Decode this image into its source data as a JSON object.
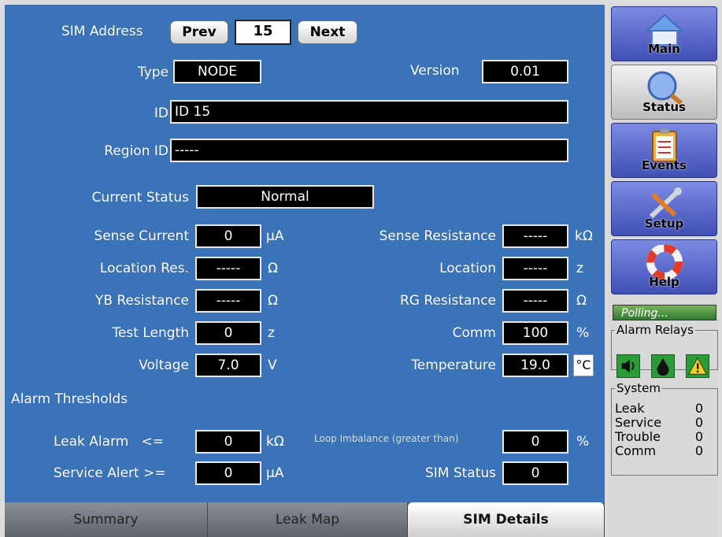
{
  "sim": {
    "address_label": "SIM Address",
    "prev_label": "Prev",
    "address_value": "15",
    "next_label": "Next"
  },
  "fields": {
    "type_label": "Type",
    "type_value": "NODE",
    "version_label": "Version",
    "version_value": "0.01",
    "id_label": "ID",
    "id_value": "ID 15",
    "region_label": "Region ID",
    "region_value": "-----",
    "current_status_label": "Current Status",
    "current_status_value": "Normal",
    "sense_current_label": "Sense Current",
    "sense_current_value": "0",
    "sense_current_unit": "μA",
    "sense_resistance_label": "Sense Resistance",
    "sense_resistance_value": "-----",
    "sense_resistance_unit": "kΩ",
    "location_res_label": "Location Res.",
    "location_res_value": "-----",
    "location_res_unit": "Ω",
    "location_label": "Location",
    "location_value": "-----",
    "location_unit": "z",
    "yb_resistance_label": "YB Resistance",
    "yb_resistance_value": "-----",
    "yb_resistance_unit": "Ω",
    "rg_resistance_label": "RG Resistance",
    "rg_resistance_value": "-----",
    "rg_resistance_unit": "Ω",
    "test_length_label": "Test Length",
    "test_length_value": "0",
    "test_length_unit": "z",
    "comm_label": "Comm",
    "comm_value": "100",
    "comm_unit": "%",
    "voltage_label": "Voltage",
    "voltage_value": "7.0",
    "voltage_unit": "V",
    "temperature_label": "Temperature",
    "temperature_value": "19.0",
    "temperature_unit": "°C",
    "alarm_thresholds_label": "Alarm Thresholds",
    "leak_alarm_label": "Leak Alarm   <=",
    "leak_alarm_value": "0",
    "leak_alarm_unit": "kΩ",
    "loop_imbalance_label": "Loop Imbalance (greater than)",
    "loop_imbalance_value": "0",
    "loop_imbalance_unit": "%",
    "service_alert_label": "Service Alert >=",
    "service_alert_value": "0",
    "service_alert_unit": "μA",
    "sim_status_label": "SIM Status",
    "sim_status_value": "0"
  },
  "tabs": [
    "Summary",
    "Leak Map",
    "SIM Details"
  ],
  "active_tab": "SIM Details",
  "nav": {
    "main": "Main",
    "status": "Status",
    "events": "Events",
    "setup": "Setup",
    "help": "Help",
    "selected": "Status",
    "icons": [
      "home-icon",
      "magnifier-icon",
      "clipboard-icon",
      "wrench-screwdriver-icon",
      "lifebuoy-icon"
    ]
  },
  "polling_text": "Polling...",
  "alarm_relays": {
    "title": "Alarm Relays",
    "icons": [
      "speaker-icon",
      "water-drop-icon",
      "warning-icon"
    ],
    "color": "#2a9b38"
  },
  "system": {
    "title": "System",
    "rows": [
      {
        "label": "Leak",
        "value": "0"
      },
      {
        "label": "Service",
        "value": "0"
      },
      {
        "label": "Trouble",
        "value": "0"
      },
      {
        "label": "Comm",
        "value": "0"
      }
    ]
  },
  "colors": {
    "panel": "#3a73b7",
    "field_bg": "#000000",
    "nav_blue": "#5b6bd0"
  }
}
